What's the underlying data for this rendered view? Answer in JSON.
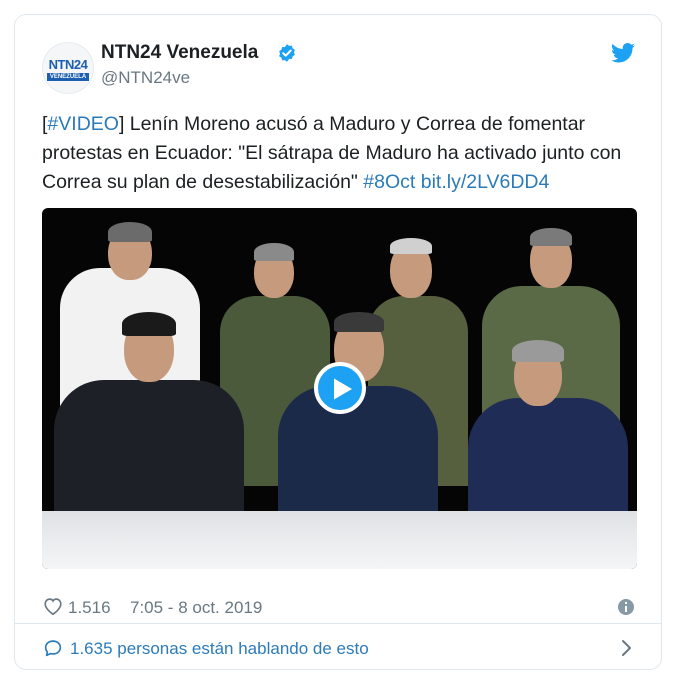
{
  "account": {
    "display_name": "NTN24 Venezuela",
    "handle": "@NTN24ve",
    "avatar_logo_text": "NTN24",
    "avatar_strip_text": "VENEZUELA",
    "verified": true
  },
  "tweet": {
    "bracket_open": "[",
    "hashtag_video": "#VIDEO",
    "body_text": "] Lenín Moreno acusó a Maduro y Correa de fomentar protestas en Ecuador: \"El sátrapa de Maduro ha activado junto con Correa su plan de desestabilización\" ",
    "hashtag_date": "#8Oct",
    "short_link": "bit.ly/2LV6DD4"
  },
  "media": {
    "type": "video",
    "play_icon": "play-icon"
  },
  "stats": {
    "likes": "1.516",
    "timestamp": "7:05 - 8 oct. 2019"
  },
  "footer": {
    "conversation_text": "1.635 personas están hablando de esto"
  },
  "colors": {
    "accent": "#1da1f2",
    "link": "#2b7bb9",
    "muted": "#697882",
    "border": "#e1e8ed"
  }
}
